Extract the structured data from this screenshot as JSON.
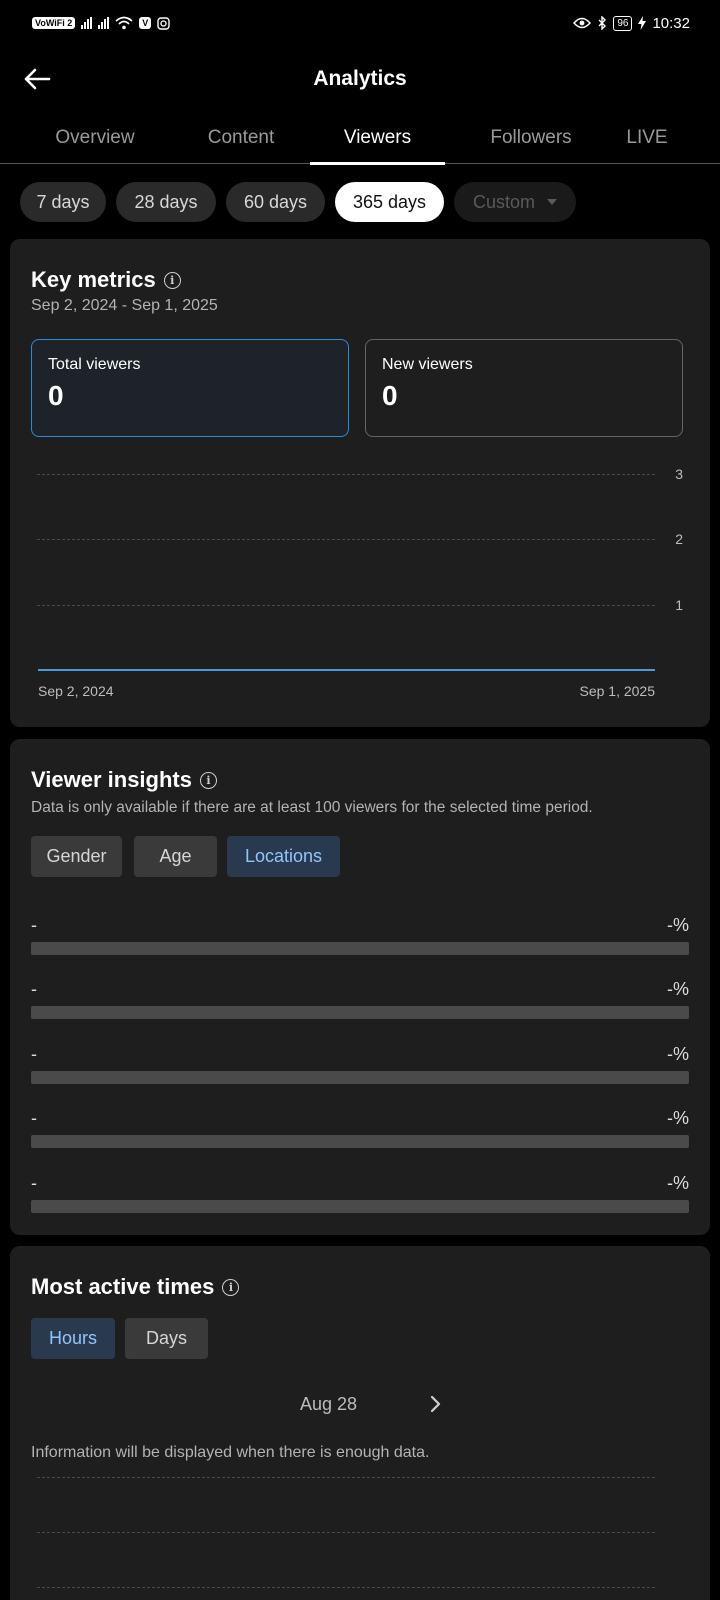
{
  "status_bar": {
    "wifi_badge": "VoWiFi 2",
    "net1": "4G",
    "net2": "4G",
    "app_badge": "V",
    "battery": "96",
    "time": "10:32"
  },
  "header": {
    "title": "Analytics"
  },
  "tabs": [
    {
      "label": "Overview",
      "active": false
    },
    {
      "label": "Content",
      "active": false
    },
    {
      "label": "Viewers",
      "active": true
    },
    {
      "label": "Followers",
      "active": false
    },
    {
      "label": "LIVE",
      "active": false
    }
  ],
  "range_chips": [
    {
      "label": "7 days"
    },
    {
      "label": "28 days"
    },
    {
      "label": "60 days"
    },
    {
      "label": "365 days",
      "active": true
    },
    {
      "label": "Custom",
      "disabled": true
    }
  ],
  "key_metrics": {
    "title": "Key metrics",
    "date_range": "Sep 2, 2024 - Sep 1, 2025",
    "total_viewers": {
      "label": "Total viewers",
      "value": "0"
    },
    "new_viewers": {
      "label": "New viewers",
      "value": "0"
    }
  },
  "chart_data": {
    "type": "line",
    "x": [
      "Sep 2, 2024",
      "Sep 1, 2025"
    ],
    "x_tick_labels": [
      "Sep 2, 2024",
      "Sep 1, 2025"
    ],
    "y_ticks": [
      "3",
      "2",
      "1"
    ],
    "series": [
      {
        "values": [
          0,
          0
        ]
      }
    ],
    "ylim": [
      0,
      3
    ],
    "grid": true,
    "color": "#4a9ae0"
  },
  "viewer_insights": {
    "title": "Viewer insights",
    "note": "Data is only available if there are at least 100 viewers for the selected time period.",
    "segments": [
      "Gender",
      "Age",
      "Locations"
    ],
    "active_segment": "Locations",
    "locations": [
      {
        "name": "-",
        "pct": "-%",
        "share": 0
      },
      {
        "name": "-",
        "pct": "-%",
        "share": 0
      },
      {
        "name": "-",
        "pct": "-%",
        "share": 0
      },
      {
        "name": "-",
        "pct": "-%",
        "share": 0
      },
      {
        "name": "-",
        "pct": "-%",
        "share": 0
      }
    ]
  },
  "active_times": {
    "title": "Most active times",
    "segments": [
      "Hours",
      "Days"
    ],
    "active_segment": "Hours",
    "date": "Aug 28",
    "empty_message": "Information will be displayed when there is enough data."
  },
  "colors": {
    "accent": "#8fc5ff",
    "selected_border": "#2f8ad6",
    "card_bg": "#1e1e1e"
  }
}
